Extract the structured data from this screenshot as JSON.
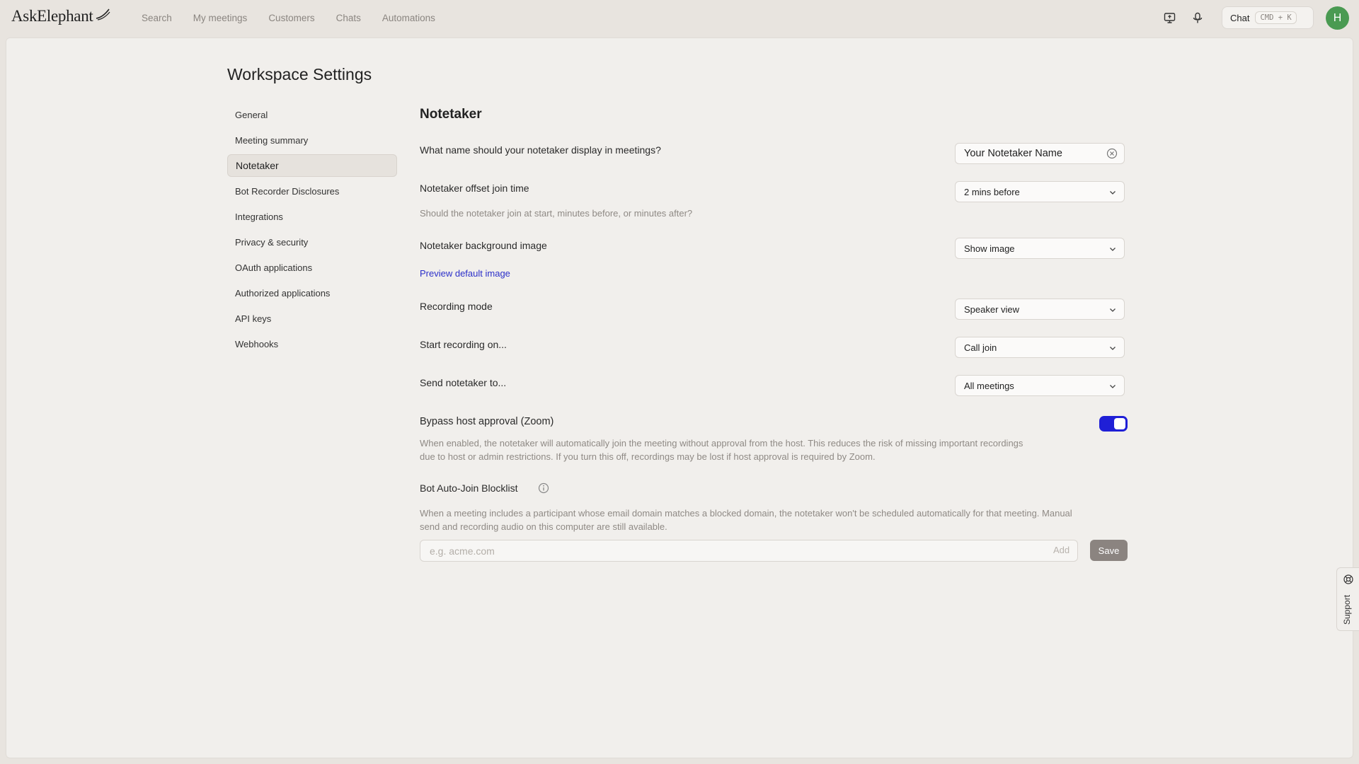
{
  "app": {
    "logo_text": "AskElephant"
  },
  "nav": {
    "items": [
      {
        "label": "Search"
      },
      {
        "label": "My meetings"
      },
      {
        "label": "Customers"
      },
      {
        "label": "Chats"
      },
      {
        "label": "Automations"
      }
    ]
  },
  "toolbar": {
    "screen_icon": "monitor-icon",
    "mic_icon": "microphone-icon",
    "chat_label": "Chat",
    "chat_shortcut": "CMD + K",
    "avatar_initial": "H",
    "avatar_color": "#4a9a52"
  },
  "page": {
    "title": "Workspace Settings"
  },
  "sidebar": {
    "items": [
      {
        "label": "General",
        "active": false
      },
      {
        "label": "Meeting summary",
        "active": false
      },
      {
        "label": "Notetaker",
        "active": true
      },
      {
        "label": "Bot Recorder Disclosures",
        "active": false
      },
      {
        "label": "Integrations",
        "active": false
      },
      {
        "label": "Privacy & security",
        "active": false
      },
      {
        "label": "OAuth applications",
        "active": false
      },
      {
        "label": "Authorized applications",
        "active": false
      },
      {
        "label": "API keys",
        "active": false
      },
      {
        "label": "Webhooks",
        "active": false
      }
    ]
  },
  "notetaker": {
    "section_title": "Notetaker",
    "display_name": {
      "label": "What name should your notetaker display in meetings?",
      "value": "Your Notetaker Name"
    },
    "offset_join": {
      "label": "Notetaker offset join time",
      "description": "Should the notetaker join at start, minutes before, or minutes after?",
      "value": "2 mins before"
    },
    "background_image": {
      "label": "Notetaker background image",
      "value": "Show image",
      "preview_link": "Preview default image"
    },
    "recording_mode": {
      "label": "Recording mode",
      "value": "Speaker view"
    },
    "start_recording": {
      "label": "Start recording on...",
      "value": "Call join"
    },
    "send_to": {
      "label": "Send notetaker to...",
      "value": "All meetings"
    },
    "bypass_host": {
      "label": "Bypass host approval (Zoom)",
      "description_line1": "When enabled, the notetaker will automatically join the meeting without approval from the host. This reduces the risk of missing important recordings",
      "description_line2": "due to host or admin restrictions. If you turn this off, recordings may be lost if host approval is required by Zoom.",
      "enabled": true,
      "accent_color": "#1f1fd6"
    },
    "blocklist": {
      "label": "Bot Auto-Join Blocklist",
      "description_line1": "When a meeting includes a participant whose email domain matches a blocked domain, the notetaker won't be scheduled automatically for that meeting. Manual",
      "description_line2": "send and recording audio on this computer are still available.",
      "placeholder": "e.g. acme.com",
      "add_label": "Add",
      "save_label": "Save"
    }
  },
  "support": {
    "label": "Support"
  }
}
